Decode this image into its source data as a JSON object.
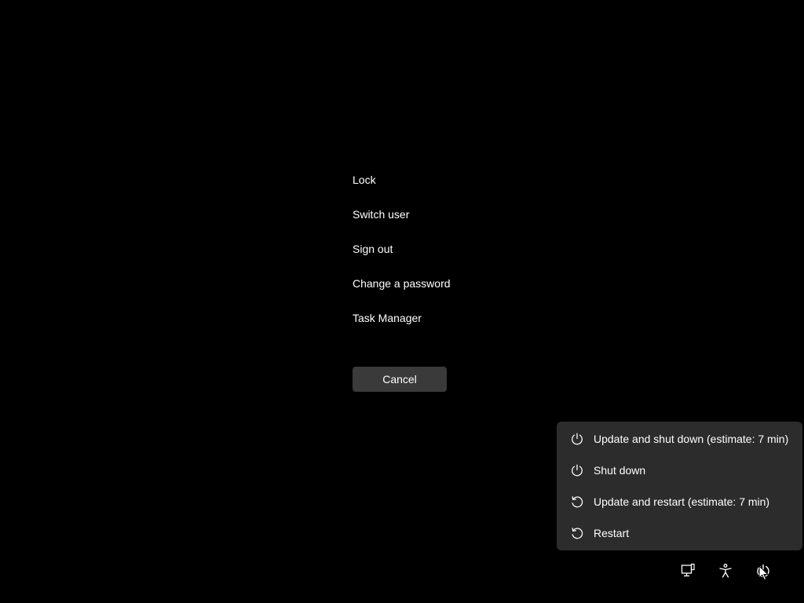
{
  "security_options": {
    "items": [
      {
        "label": "Lock"
      },
      {
        "label": "Switch user"
      },
      {
        "label": "Sign out"
      },
      {
        "label": "Change a password"
      },
      {
        "label": "Task Manager"
      }
    ],
    "cancel_label": "Cancel"
  },
  "power_menu": {
    "items": [
      {
        "label": "Update and shut down (estimate: 7 min)",
        "icon": "power-icon"
      },
      {
        "label": "Shut down",
        "icon": "power-icon"
      },
      {
        "label": "Update and restart (estimate: 7 min)",
        "icon": "restart-icon"
      },
      {
        "label": "Restart",
        "icon": "restart-icon"
      }
    ]
  },
  "tray": {
    "icons": [
      "network-icon",
      "accessibility-icon",
      "power-icon"
    ]
  },
  "colors": {
    "background": "#000000",
    "menu_background": "#2c2c2c",
    "button_background": "#3a3a3a",
    "text": "#ffffff"
  }
}
